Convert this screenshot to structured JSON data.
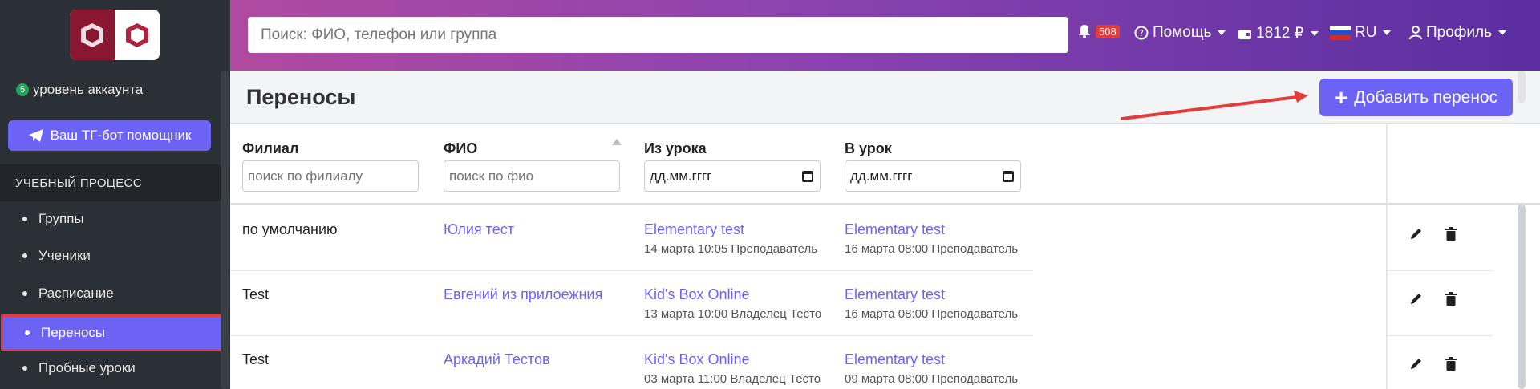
{
  "sidebar": {
    "level_badge": "5",
    "level_label": "уровень аккаунта",
    "tg_button": "Ваш ТГ-бот помощник",
    "section_title": "УЧЕБНЫЙ ПРОЦЕСС",
    "items": [
      {
        "label": "Группы",
        "active": false
      },
      {
        "label": "Ученики",
        "active": false
      },
      {
        "label": "Расписание",
        "active": false
      },
      {
        "label": "Переносы",
        "active": true
      },
      {
        "label": "Пробные уроки",
        "active": false
      }
    ]
  },
  "header": {
    "search_placeholder": "Поиск: ФИО, телефон или группа",
    "notifications_count": "508",
    "help_label": "Помощь",
    "balance_label": "1812 ₽",
    "lang_label": "RU",
    "profile_label": "Профиль"
  },
  "page": {
    "title": "Переносы",
    "add_button": "Добавить перенос"
  },
  "table": {
    "columns": [
      {
        "label": "Филиал",
        "placeholder": "поиск по филиалу"
      },
      {
        "label": "ФИО",
        "placeholder": "поиск по фио"
      },
      {
        "label": "Из урока",
        "placeholder": "дд.мм.гггг"
      },
      {
        "label": "В урок",
        "placeholder": "дд.мм.гггг"
      }
    ],
    "rows": [
      {
        "branch": "по умолчанию",
        "name": "Юлия тест",
        "from_lesson": "Elementary test",
        "from_meta": "14 марта 10:05   Преподаватель",
        "to_lesson": "Elementary test",
        "to_meta": "16 марта 08:00   Преподаватель"
      },
      {
        "branch": "Test",
        "name": "Евгений из прилоежния",
        "from_lesson": "Kid's Box Online",
        "from_meta": "13 марта 10:00   Владелец Тесто",
        "to_lesson": "Elementary test",
        "to_meta": "16 марта 08:00   Преподаватель"
      },
      {
        "branch": "Test",
        "name": "Аркадий Тестов",
        "from_lesson": "Kid's Box Online",
        "from_meta": "03 марта 11:00   Владелец Тесто",
        "to_lesson": "Elementary test",
        "to_meta": "09 марта 08:00   Преподаватель"
      }
    ]
  },
  "colors": {
    "accent": "#6c63f5",
    "sidebar_bg": "#2b3036",
    "highlight_red": "#e23c3c"
  }
}
